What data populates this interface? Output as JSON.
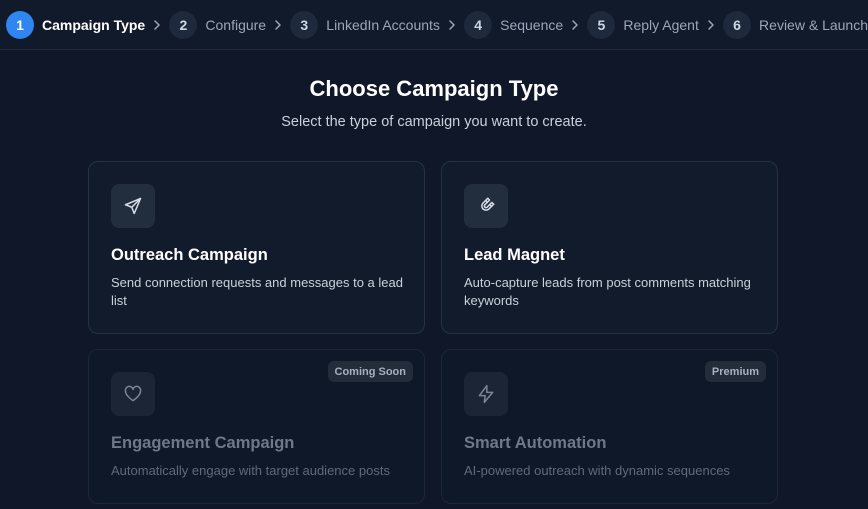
{
  "stepper": {
    "steps": [
      {
        "number": "1",
        "label": "Campaign Type"
      },
      {
        "number": "2",
        "label": "Configure"
      },
      {
        "number": "3",
        "label": "LinkedIn Accounts"
      },
      {
        "number": "4",
        "label": "Sequence"
      },
      {
        "number": "5",
        "label": "Reply Agent"
      },
      {
        "number": "6",
        "label": "Review & Launch"
      }
    ],
    "active_step": 1
  },
  "main": {
    "title": "Choose Campaign Type",
    "subtitle": "Select the type of campaign you want to create."
  },
  "cards": [
    {
      "title": "Outreach Campaign",
      "description": "Send connection requests and messages to a lead list",
      "icon": "send-icon",
      "badge": "",
      "enabled": true
    },
    {
      "title": "Lead Magnet",
      "description": "Auto-capture leads from post comments matching keywords",
      "icon": "magnet-icon",
      "badge": "",
      "enabled": true
    },
    {
      "title": "Engagement Campaign",
      "description": "Automatically engage with target audience posts",
      "icon": "heart-icon",
      "badge": "Coming Soon",
      "enabled": false
    },
    {
      "title": "Smart Automation",
      "description": "AI-powered outreach with dynamic sequences",
      "icon": "lightning-icon",
      "badge": "Premium",
      "enabled": false
    }
  ],
  "colors": {
    "background": "#0f1728",
    "accent": "#2f86f0",
    "card_border": "#253246"
  }
}
